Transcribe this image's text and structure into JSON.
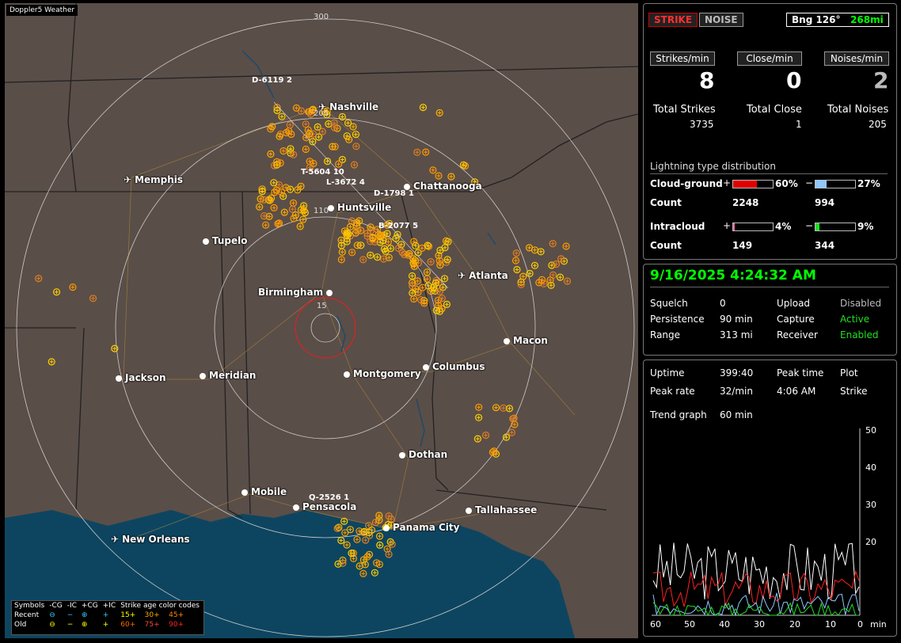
{
  "map": {
    "title": "Doppler5 Weather",
    "range_labels": [
      "300",
      "205",
      "110",
      "15"
    ],
    "cities": [
      {
        "name": "Nashville",
        "kind": "plane"
      },
      {
        "name": "Memphis",
        "kind": "plane"
      },
      {
        "name": "Chattanooga",
        "kind": "dot"
      },
      {
        "name": "Huntsville",
        "kind": "dot"
      },
      {
        "name": "Tupelo",
        "kind": "dot"
      },
      {
        "name": "Atlanta",
        "kind": "plane"
      },
      {
        "name": "Birmingham",
        "kind": "dot"
      },
      {
        "name": "Macon",
        "kind": "dot"
      },
      {
        "name": "Jackson",
        "kind": "plane"
      },
      {
        "name": "Meridian",
        "kind": "dot"
      },
      {
        "name": "Montgomery",
        "kind": "dot"
      },
      {
        "name": "Columbus",
        "kind": "dot"
      },
      {
        "name": "Dothan",
        "kind": "dot"
      },
      {
        "name": "Mobile",
        "kind": "dot"
      },
      {
        "name": "Pensacola",
        "kind": "dot"
      },
      {
        "name": "Panama City",
        "kind": "plane"
      },
      {
        "name": "Tallahassee",
        "kind": "dot"
      },
      {
        "name": "New Orleans",
        "kind": "plane"
      }
    ],
    "storm_labels": [
      "D-6119  2",
      "T-5604  10",
      "L-3672  4",
      "D-1798  1",
      "B-2077  5",
      "Q-2526  1"
    ],
    "legend": {
      "header": [
        "Symbols",
        "-CG",
        "-IC",
        "+CG",
        "+IC",
        "Strike age color codes"
      ],
      "recent": {
        "label": "Recent",
        "ages": [
          "15+",
          "30+",
          "45+"
        ]
      },
      "old": {
        "label": "Old",
        "ages": [
          "60+",
          "75+",
          "90+"
        ]
      }
    }
  },
  "stats": {
    "strike_btn": "STRIKE",
    "noise_btn": "NOISE",
    "bearing": "Bng 126°",
    "bearing_dist": "268mi",
    "strikes_per_min_label": "Strikes/min",
    "close_per_min_label": "Close/min",
    "noises_per_min_label": "Noises/min",
    "strikes_per_min": "8",
    "close_per_min": "0",
    "noises_per_min": "2",
    "total_strikes_label": "Total Strikes",
    "total_close_label": "Total Close",
    "total_noises_label": "Total Noises",
    "total_strikes": "3735",
    "total_close": "1",
    "total_noises": "205",
    "dist_title": "Lightning type distribution",
    "cg_label": "Cloud-ground",
    "ic_label": "Intracloud",
    "count_label": "Count",
    "cg_pos_pct": "60%",
    "cg_neg_pct": "27%",
    "ic_pos_pct": "4%",
    "ic_neg_pct": "9%",
    "cg_pos_val": 0.6,
    "cg_neg_val": 0.27,
    "ic_pos_val": 0.04,
    "ic_neg_val": 0.09,
    "cg_pos_count": "2248",
    "cg_neg_count": "994",
    "ic_pos_count": "149",
    "ic_neg_count": "344"
  },
  "status": {
    "datetime": "9/16/2025 4:24:32 AM",
    "squelch_label": "Squelch",
    "squelch": "0",
    "upload_label": "Upload",
    "upload": "Disabled",
    "persistence_label": "Persistence",
    "persistence": "90 min",
    "capture_label": "Capture",
    "capture": "Active",
    "range_label": "Range",
    "range": "313 mi",
    "receiver_label": "Receiver",
    "receiver": "Enabled"
  },
  "trend": {
    "uptime_label": "Uptime",
    "uptime": "399:40",
    "peak_time_label": "Peak time",
    "plot_label": "Plot",
    "peak_rate_label": "Peak rate",
    "peak_rate": "32/min",
    "peak_time": "4:06 AM",
    "plot": "Strike",
    "trend_graph_label": "Trend graph",
    "trend_graph": "60 min",
    "y_ticks": [
      "50",
      "40",
      "30",
      "20"
    ],
    "x_ticks": [
      "60",
      "50",
      "40",
      "30",
      "20",
      "10",
      "0"
    ],
    "x_unit": "min"
  },
  "colors": {
    "accent": "#00ff00",
    "strike_red": "#ff2020",
    "positive_bar": "#e00000",
    "negative_bar": "#8ec8ff",
    "ic_pos": "#ff5fa0",
    "ic_neg": "#20e020",
    "disabled": "#bbbbbb"
  }
}
